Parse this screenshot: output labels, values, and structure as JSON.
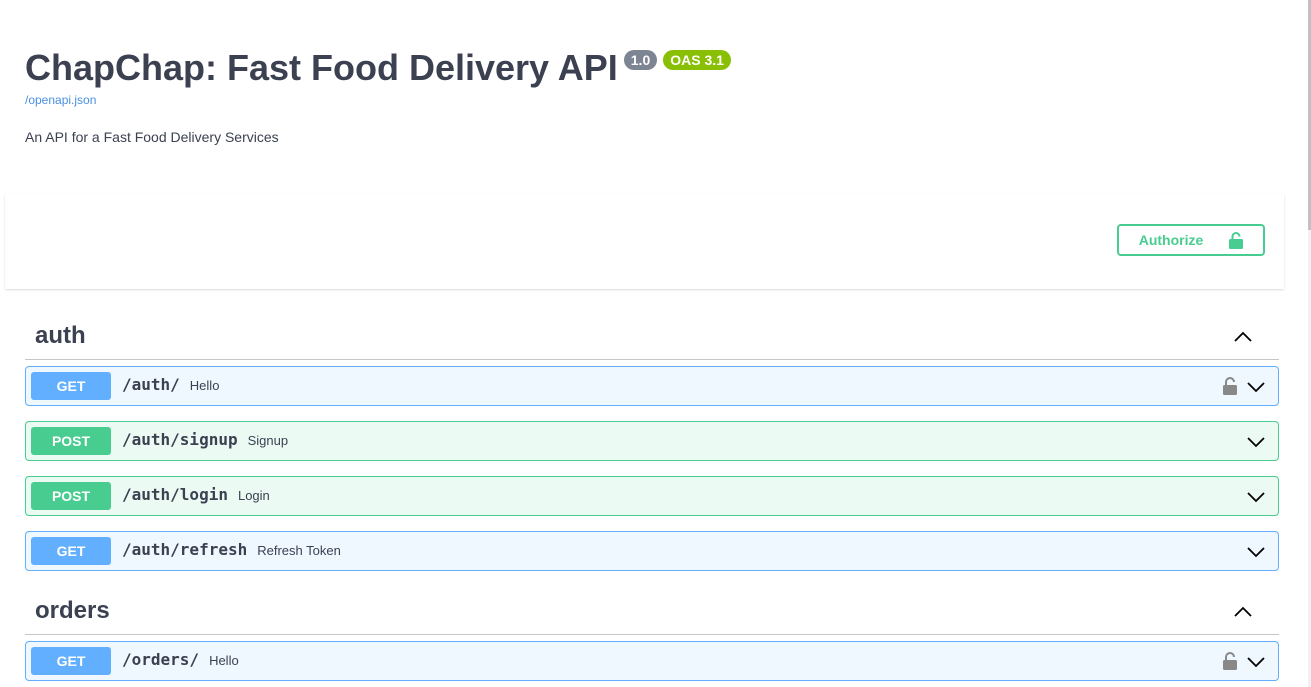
{
  "info": {
    "title": "ChapChap: Fast Food Delivery API",
    "version": "1.0",
    "oas": "OAS 3.1",
    "spec_link": "/openapi.json",
    "description": "An API for a Fast Food Delivery Services"
  },
  "authorize": {
    "label": "Authorize",
    "icon": "unlocked-lock-icon"
  },
  "colors": {
    "get": "#61affe",
    "post": "#49cc90",
    "version_badge": "#7d8492",
    "oas_badge": "#89bf04",
    "link": "#4990e2"
  },
  "tags": [
    {
      "name": "auth",
      "operations": [
        {
          "method": "GET",
          "path": "/auth/",
          "summary": "Hello",
          "locked": true
        },
        {
          "method": "POST",
          "path": "/auth/signup",
          "summary": "Signup",
          "locked": false
        },
        {
          "method": "POST",
          "path": "/auth/login",
          "summary": "Login",
          "locked": false
        },
        {
          "method": "GET",
          "path": "/auth/refresh",
          "summary": "Refresh Token",
          "locked": false
        }
      ]
    },
    {
      "name": "orders",
      "operations": [
        {
          "method": "GET",
          "path": "/orders/",
          "summary": "Hello",
          "locked": true
        }
      ]
    }
  ]
}
